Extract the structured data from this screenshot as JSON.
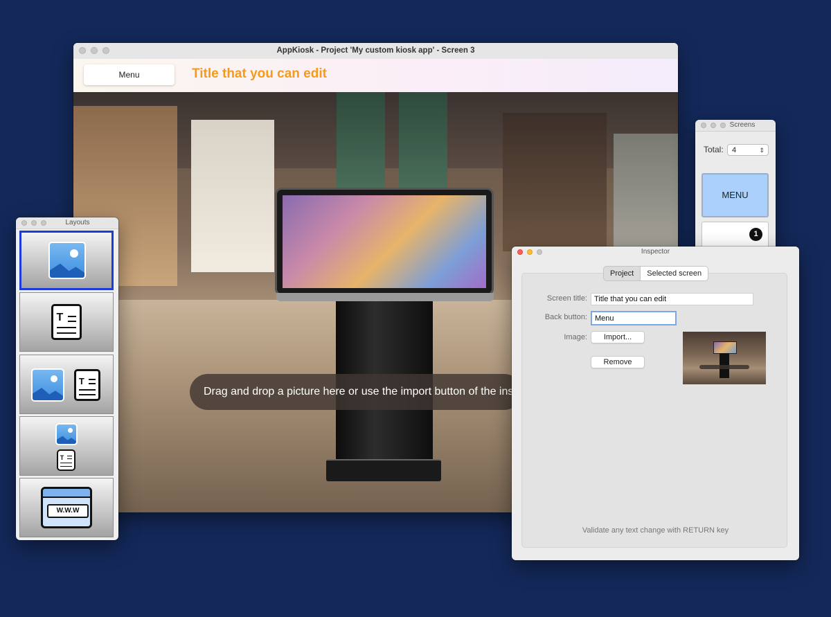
{
  "main_window": {
    "title": "AppKiosk - Project 'My custom kiosk app' - Screen 3",
    "menu_button": "Menu",
    "screen_title": "Title that you can edit",
    "drop_hint": "Drag and drop a picture here or use the import button of the inspector"
  },
  "screens_panel": {
    "title": "Screens",
    "total_label": "Total:",
    "total_value": "4",
    "cards": [
      {
        "label": "MENU"
      },
      {
        "badge": "1"
      }
    ]
  },
  "layouts_panel": {
    "title": "Layouts",
    "tiles": [
      {
        "icon": "image-icon",
        "selected": true
      },
      {
        "icon": "text-icon"
      },
      {
        "icon": "image-and-text-icon"
      },
      {
        "icon": "image-above-text-icon"
      },
      {
        "icon": "web-icon",
        "text": "W.W.W"
      }
    ]
  },
  "inspector": {
    "title": "Inspector",
    "tabs": [
      "Project",
      "Selected screen"
    ],
    "active_tab": "Selected screen",
    "screen_title_label": "Screen title:",
    "screen_title_value": "Title that you can edit",
    "back_button_label": "Back button:",
    "back_button_value": "Menu",
    "image_label": "Image:",
    "import_button": "Import...",
    "remove_button": "Remove",
    "hint": "Validate any text change with RETURN key"
  },
  "colors": {
    "background": "#14295a",
    "title_orange": "#f59a1d",
    "selection_blue": "#1d3bd8",
    "menu_card_blue": "#aad0fb"
  }
}
